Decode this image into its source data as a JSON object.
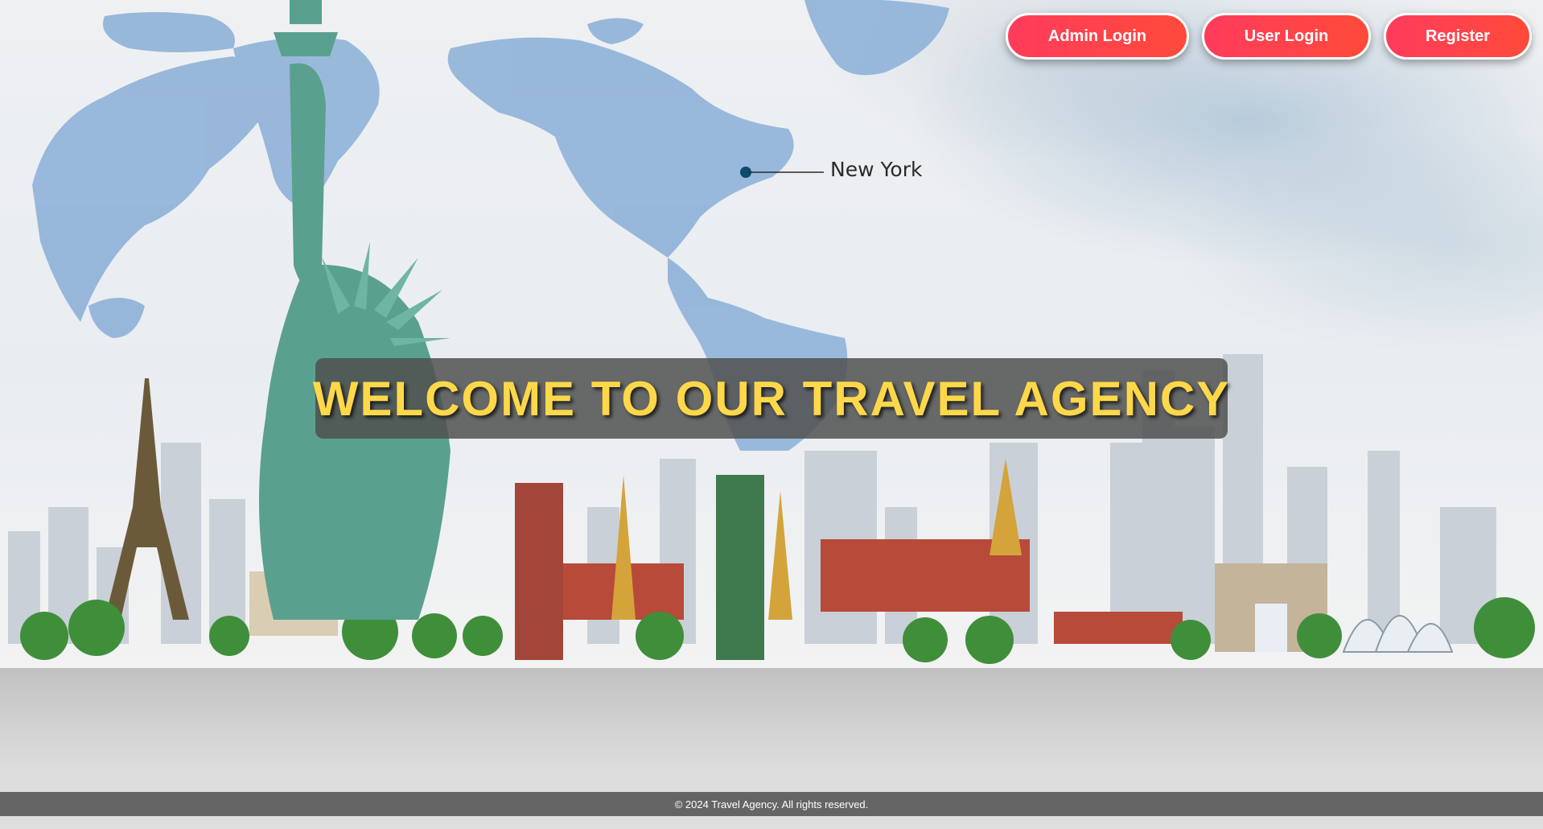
{
  "header": {
    "admin_login_label": "Admin Login",
    "user_login_label": "User Login",
    "register_label": "Register"
  },
  "hero": {
    "map_location_label": "New York",
    "welcome_text": "WELCOME TO OUR TRAVEL AGENCY"
  },
  "footer": {
    "copyright": "© 2024 Travel Agency. All rights reserved."
  },
  "colors": {
    "button_gradient_start": "#ff3c5c",
    "button_gradient_end": "#ff4a3a",
    "banner_text": "#ffd84a",
    "map_land": "#8fb2d8"
  }
}
